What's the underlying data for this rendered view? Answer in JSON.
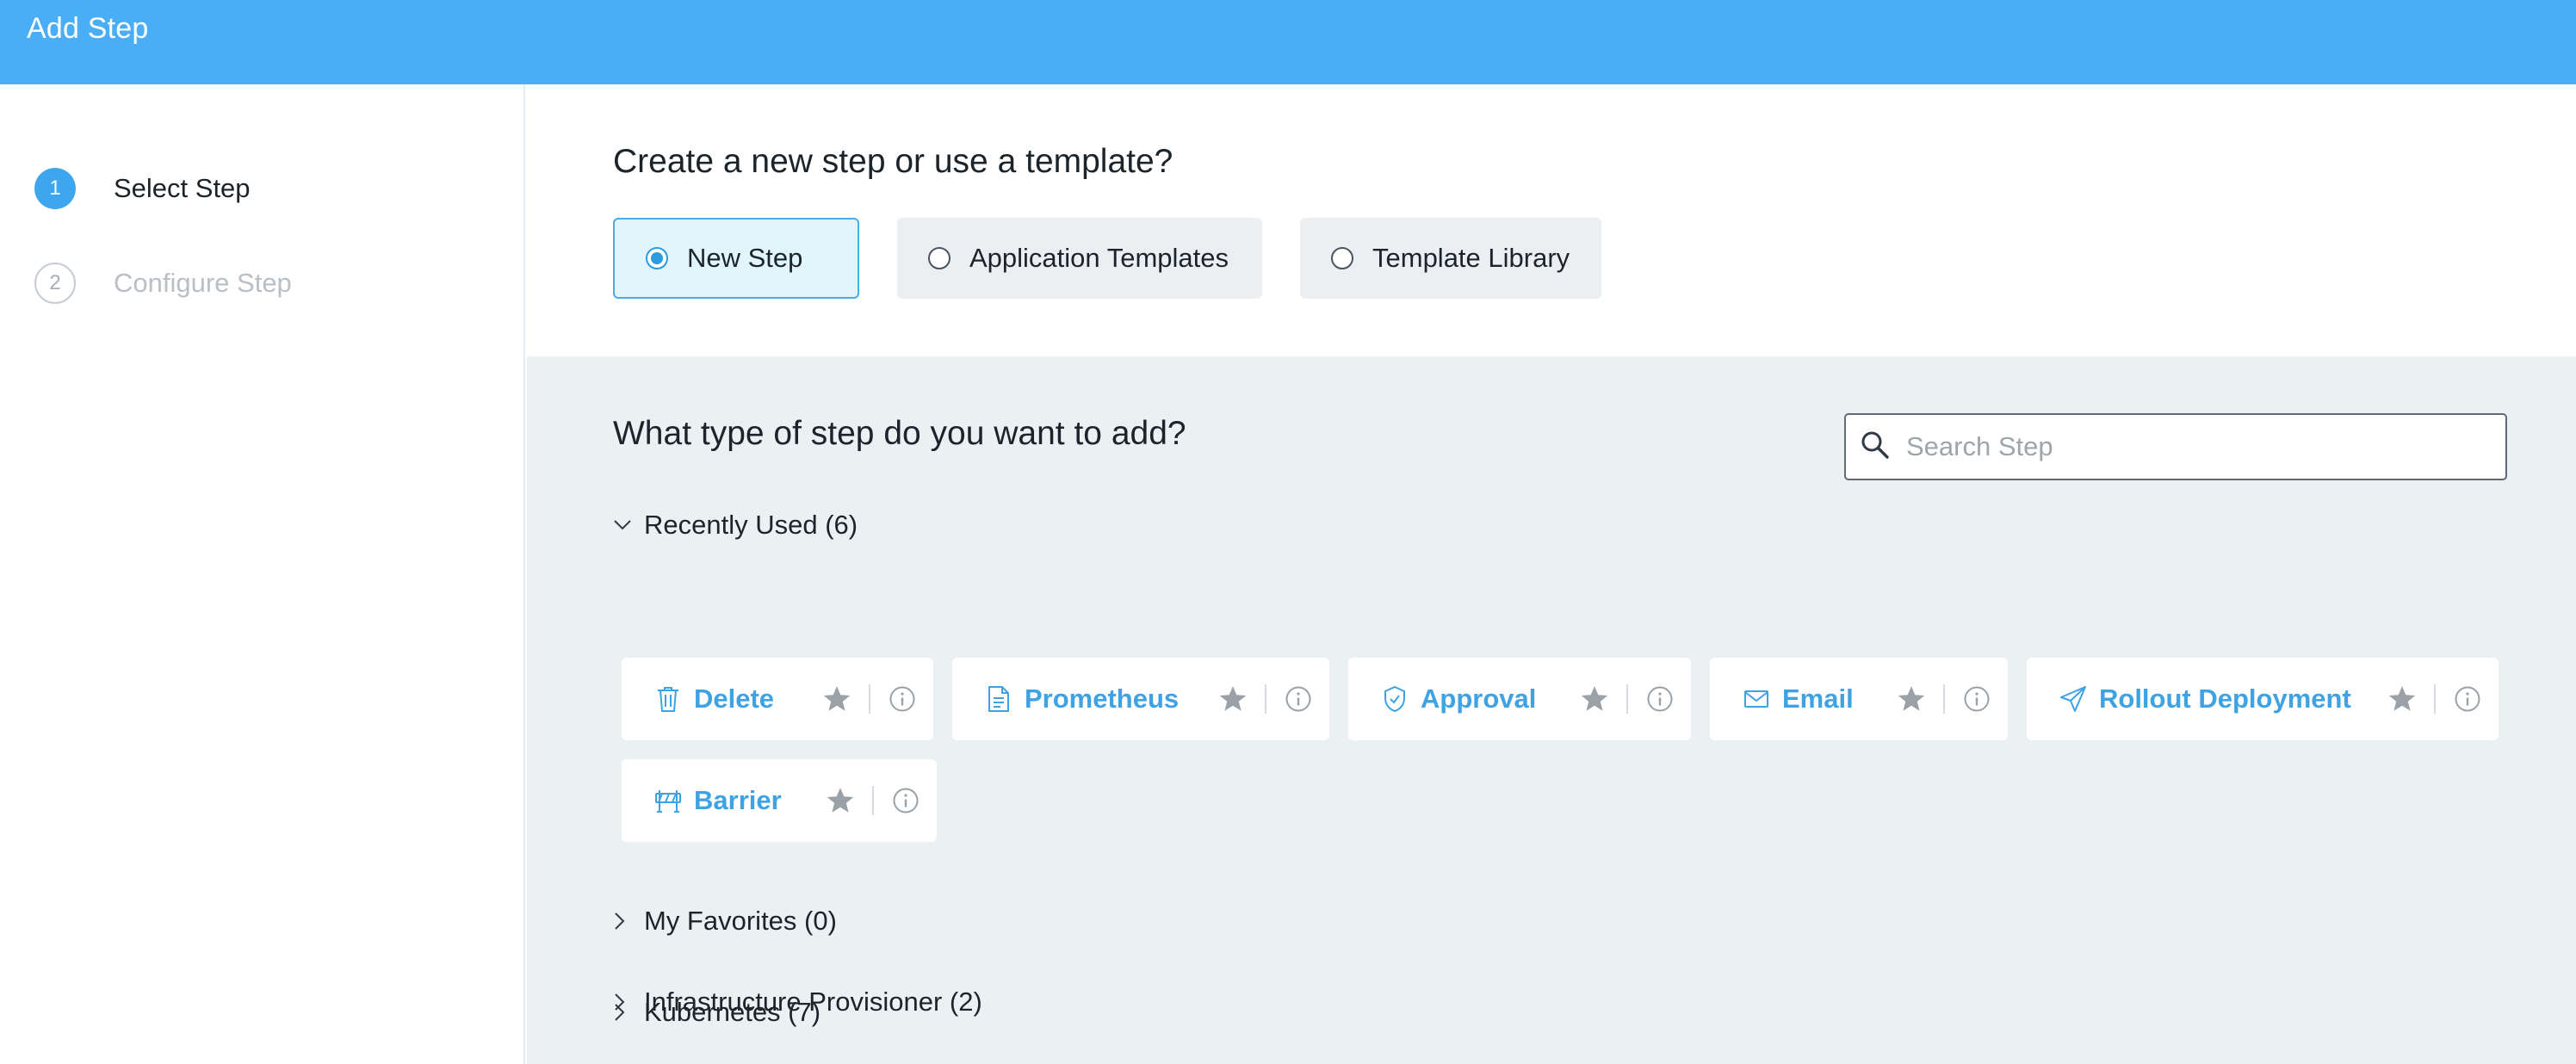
{
  "header": {
    "title": "Add Step"
  },
  "wizard": {
    "steps": [
      {
        "number": "1",
        "label": "Select Step",
        "state": "active"
      },
      {
        "number": "2",
        "label": "Configure Step",
        "state": "inactive"
      }
    ]
  },
  "creation": {
    "question": "Create a new step or use a template?",
    "options": [
      {
        "label": "New Step",
        "selected": true
      },
      {
        "label": "Application Templates",
        "selected": false
      },
      {
        "label": "Template Library",
        "selected": false
      }
    ]
  },
  "step_type": {
    "question": "What type of step do you want to add?",
    "search": {
      "placeholder": "Search Step",
      "value": ""
    },
    "sections": [
      {
        "label": "Recently Used (6)",
        "expanded": true,
        "items": [
          {
            "label": "Delete",
            "icon": "trash-icon"
          },
          {
            "label": "Prometheus",
            "icon": "document-chart-icon"
          },
          {
            "label": "Approval",
            "icon": "shield-check-icon"
          },
          {
            "label": "Email",
            "icon": "envelope-icon"
          },
          {
            "label": "Rollout Deployment",
            "icon": "paper-plane-icon"
          },
          {
            "label": "Barrier",
            "icon": "barrier-icon"
          }
        ]
      },
      {
        "label": "My Favorites (0)",
        "expanded": false
      },
      {
        "label": "Kubernetes (7)",
        "expanded": false
      },
      {
        "label": "Infrastructure Provisioner (2)",
        "expanded": false
      }
    ]
  },
  "colors": {
    "header": "#4aaef6",
    "accent": "#3ea2e3",
    "panel": "#ebf0f3"
  }
}
